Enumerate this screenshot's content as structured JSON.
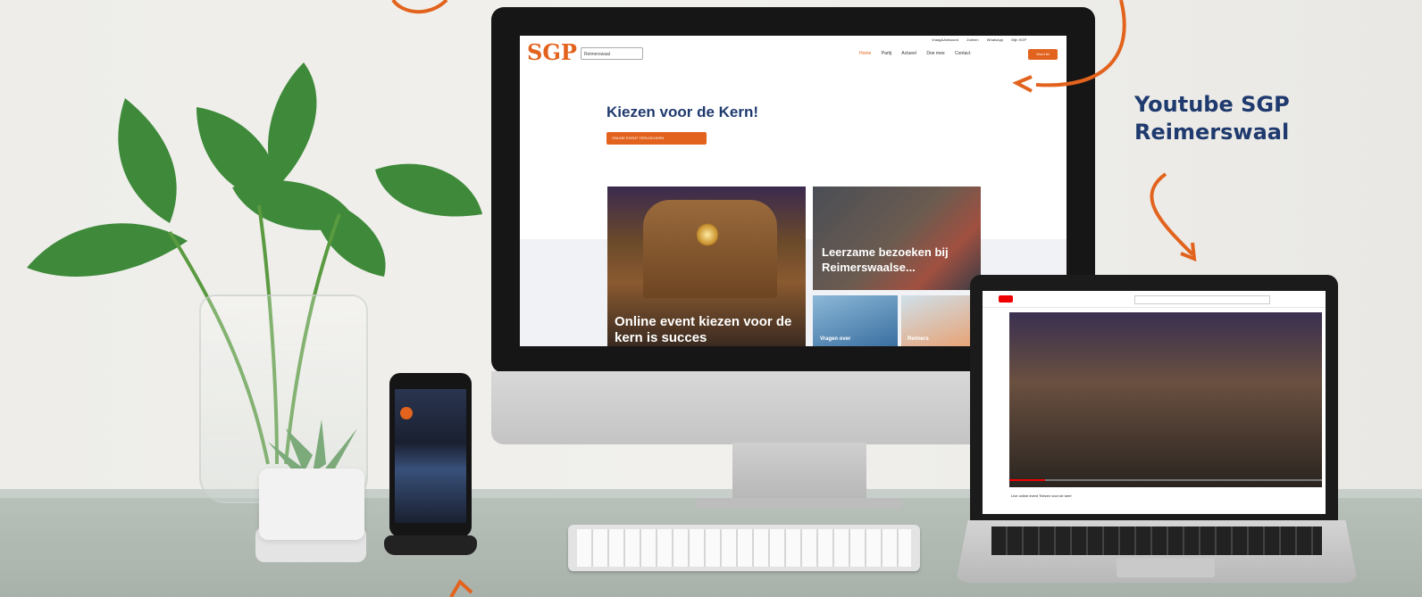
{
  "annotation": {
    "line1": "Youtube SGP",
    "line2": "Reimerswaal"
  },
  "colors": {
    "accent": "#e2631d",
    "navy": "#1f3a6e"
  },
  "website": {
    "logo": "SGP",
    "select_value": "Reimerswaal",
    "utility_links": [
      "Vraag&Antwoord",
      "Zoeken",
      "WhatsApp",
      "Mijn SGP"
    ],
    "nav": [
      "Home",
      "Partij",
      "Actueel",
      "Doe mee",
      "Contact"
    ],
    "nav_button": "Word lid",
    "hero_title": "Kiezen voor de Kern!",
    "hero_button": "ONLINE EVENT TERUGKIJKEN",
    "card_big_title": "Online event kiezen voor de kern is succes",
    "card_top_right_title": "Leerzame bezoeken bij Reimerswaalse...",
    "card_bottom_left_title": "Vragen over",
    "card_bottom_right_title": "Reimers"
  },
  "youtube": {
    "caption": "Live online event 'Kiezen voor de kern'"
  }
}
